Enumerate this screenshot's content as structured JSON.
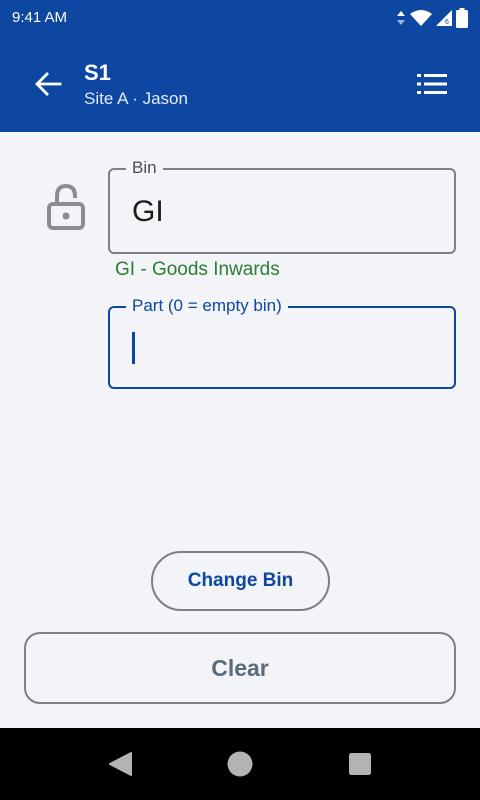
{
  "status_bar": {
    "time": "9:41 AM",
    "icons": [
      "data-arrows-icon",
      "wifi-icon",
      "signal-icon",
      "battery-icon"
    ]
  },
  "app_bar": {
    "title": "S1",
    "subtitle": "Site A · Jason",
    "back_icon": "arrow-left-icon",
    "menu_icon": "list-icon",
    "color": "#0d47a1"
  },
  "form": {
    "lock_icon": "lock-open-icon",
    "bin": {
      "label": "Bin",
      "value": "GI",
      "helper": "GI - Goods Inwards",
      "helper_color": "#2e7d32"
    },
    "part": {
      "label": "Part  (0 = empty bin)",
      "value": "",
      "focused": true,
      "accent": "#0d47a1"
    }
  },
  "actions": {
    "change_bin_label": "Change Bin",
    "clear_label": "Clear"
  },
  "nav_bar": {
    "back_icon": "triangle-back-icon",
    "home_icon": "circle-home-icon",
    "recents_icon": "square-recents-icon"
  }
}
